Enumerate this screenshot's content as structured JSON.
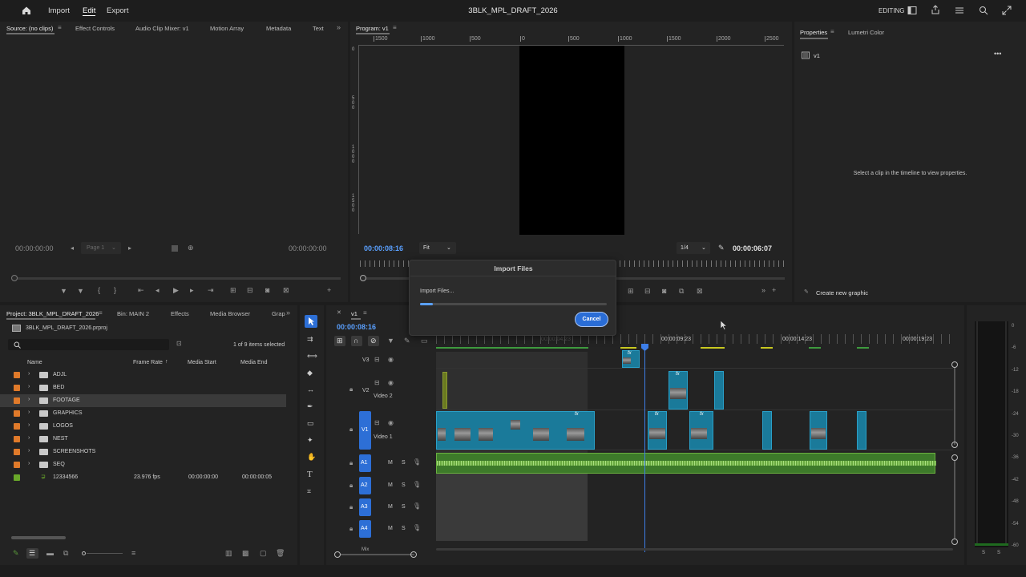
{
  "topbar": {
    "home_icon": "home-icon",
    "menus": [
      "Import",
      "Edit",
      "Export"
    ],
    "project_title": "3BLK_MPL_DRAFT_2026",
    "workspace": "EDITING"
  },
  "source_panel": {
    "tabs": [
      "Source: (no clips)",
      "Effect Controls",
      "Audio Clip Mixer: v1",
      "Motion Array",
      "Metadata",
      "Text"
    ],
    "timecode_in": "00:00:00:00",
    "page": "Page 1",
    "timecode_out": "00:00:00:00"
  },
  "program_panel": {
    "tab": "Program: v1",
    "ruler": [
      "1500",
      "1000",
      "500",
      "0",
      "500",
      "1000",
      "1500",
      "2000",
      "2500"
    ],
    "vruler": [
      "0",
      "5 0 0",
      "1 0 0 0",
      "1 5 0 0"
    ],
    "timecode": "00:00:08:16",
    "fit": "Fit",
    "quality": "1/4",
    "duration": "00:00:06:07"
  },
  "properties_panel": {
    "tabs": [
      "Properties",
      "Lumetri Color"
    ],
    "item": "v1",
    "empty_message": "Select a clip in the timeline to view properties.",
    "create_graphic": "Create new graphic"
  },
  "project_panel": {
    "tabs": [
      "Project: 3BLK_MPL_DRAFT_2026",
      "Bin: MAIN 2",
      "Effects",
      "Media Browser",
      "Grap"
    ],
    "project_file": "3BLK_MPL_DRAFT_2026.prproj",
    "selection_count": "1 of 9 items selected",
    "columns": [
      "Name",
      "Frame Rate",
      "Media Start",
      "Media End"
    ],
    "rows": [
      {
        "name": "ADJL",
        "color": "#e07a2a",
        "frame_rate": "",
        "media_start": "",
        "media_end": ""
      },
      {
        "name": "BED",
        "color": "#e07a2a",
        "frame_rate": "",
        "media_start": "",
        "media_end": ""
      },
      {
        "name": "FOOTAGE",
        "color": "#e07a2a",
        "frame_rate": "",
        "media_start": "",
        "media_end": ""
      },
      {
        "name": "GRAPHICS",
        "color": "#e07a2a",
        "frame_rate": "",
        "media_start": "",
        "media_end": ""
      },
      {
        "name": "LOGOS",
        "color": "#e07a2a",
        "frame_rate": "",
        "media_start": "",
        "media_end": ""
      },
      {
        "name": "NEST",
        "color": "#e07a2a",
        "frame_rate": "",
        "media_start": "",
        "media_end": ""
      },
      {
        "name": "SCREENSHOTS",
        "color": "#e07a2a",
        "frame_rate": "",
        "media_start": "",
        "media_end": ""
      },
      {
        "name": "SEQ",
        "color": "#e07a2a",
        "frame_rate": "",
        "media_start": "",
        "media_end": ""
      },
      {
        "name": "12334566",
        "color": "#6aa82a",
        "frame_rate": "23.976 fps",
        "media_start": "00:00:00:00",
        "media_end": "00:00:00:05"
      }
    ]
  },
  "timeline": {
    "sequence_tab": "v1",
    "timecode": "00:00:08:16",
    "ruler": [
      "00:00:04:23",
      "00:00:09:23",
      "00:00:14:23",
      "00:00:19:23"
    ],
    "tracks": {
      "v3": "V3",
      "v2": "V2",
      "v2_name": "Video 2",
      "v1": "V1",
      "v1_name": "Video 1",
      "a1": "A1",
      "a2": "A2",
      "a3": "A3",
      "a4": "A4",
      "m": "M",
      "s": "S",
      "fx": "fx",
      "mix": "Mix"
    }
  },
  "audio_meter": {
    "scale": [
      "0",
      "-6",
      "-12",
      "-18",
      "-24",
      "-30",
      "-36",
      "-42",
      "-48",
      "-54",
      "-60"
    ],
    "s1": "S",
    "s2": "S"
  },
  "dialog": {
    "title": "Import Files",
    "status": "Import Files...",
    "progress": 0.07,
    "cancel": "Cancel"
  }
}
